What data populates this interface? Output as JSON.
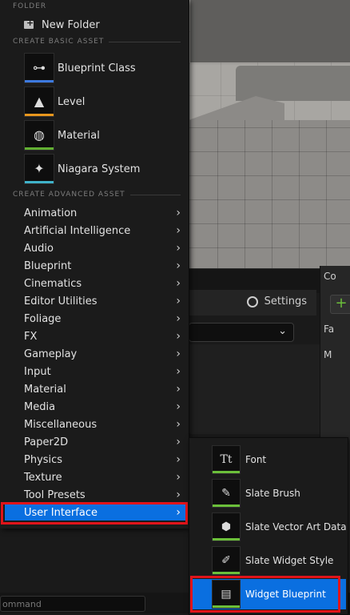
{
  "background": {
    "settings_label": "Settings",
    "command_placeholder": "ommand",
    "right_panel": {
      "r1": "Co",
      "r2": "+",
      "r3": "Fa",
      "r4": "M"
    }
  },
  "menu": {
    "folder_header": "FOLDER",
    "new_folder_label": "New Folder",
    "basic_header": "CREATE BASIC ASSET",
    "basic_assets": [
      {
        "label": "Blueprint Class",
        "icon": "blueprint-class-icon",
        "color": "#3d7ae0"
      },
      {
        "label": "Level",
        "icon": "level-icon",
        "color": "#e8961d"
      },
      {
        "label": "Material",
        "icon": "material-icon",
        "color": "#62b032"
      },
      {
        "label": "Niagara System",
        "icon": "niagara-icon",
        "color": "#3fb2c9"
      }
    ],
    "advanced_header": "CREATE ADVANCED ASSET",
    "categories": [
      "Animation",
      "Artificial Intelligence",
      "Audio",
      "Blueprint",
      "Cinematics",
      "Editor Utilities",
      "Foliage",
      "FX",
      "Gameplay",
      "Input",
      "Material",
      "Media",
      "Miscellaneous",
      "Paper2D",
      "Physics",
      "Texture",
      "Tool Presets",
      "User Interface"
    ],
    "selected_category": "User Interface"
  },
  "submenu": {
    "items": [
      {
        "label": "Font",
        "icon": "font-icon",
        "glyph": "Tt"
      },
      {
        "label": "Slate Brush",
        "icon": "slate-brush-icon",
        "glyph": "✎"
      },
      {
        "label": "Slate Vector Art Data",
        "icon": "vector-art-icon",
        "glyph": "⬢"
      },
      {
        "label": "Slate Widget Style",
        "icon": "widget-style-icon",
        "glyph": "✐"
      },
      {
        "label": "Widget Blueprint",
        "icon": "widget-blueprint-icon",
        "glyph": "▤"
      }
    ],
    "selected": "Widget Blueprint"
  },
  "colors": {
    "selection": "#0a6fe0",
    "highlight": "#e0141a",
    "ui_bar": "#6bbf3a"
  }
}
